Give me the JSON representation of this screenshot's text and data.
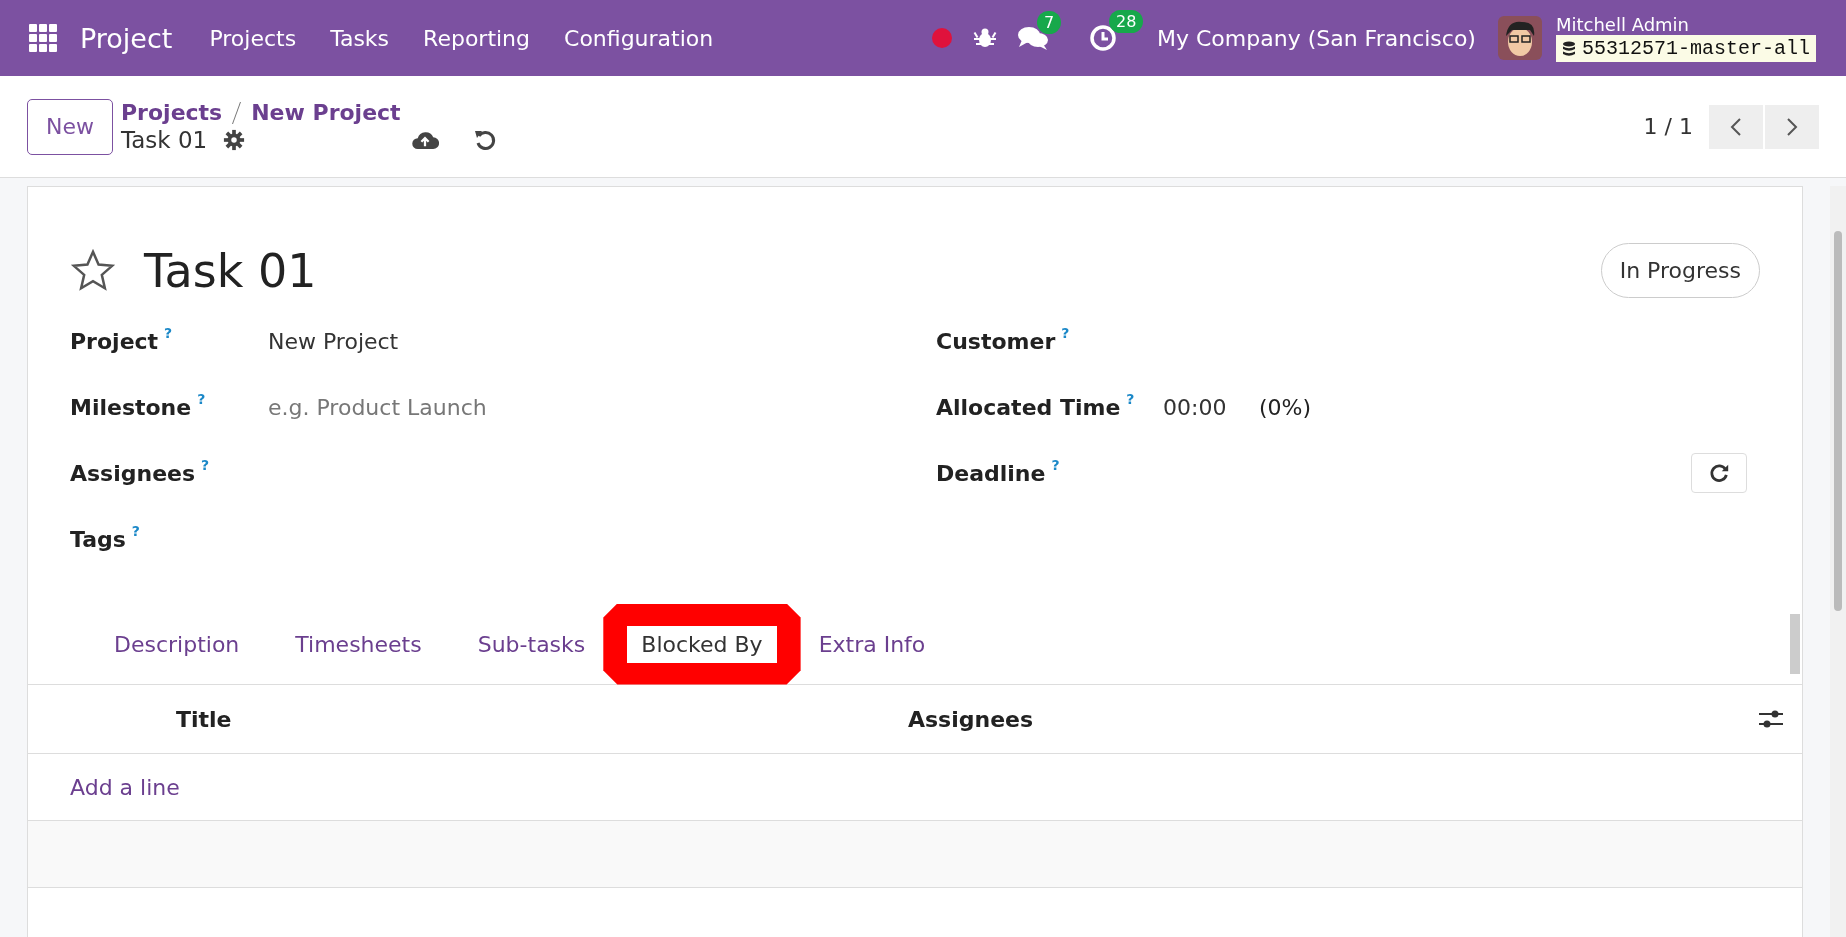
{
  "navbar": {
    "app_name": "Project",
    "menu": [
      "Projects",
      "Tasks",
      "Reporting",
      "Configuration"
    ],
    "messages_count": "7",
    "activities_count": "28",
    "company": "My Company (San Francisco)",
    "user_name": "Mitchell Admin",
    "database": "55312571-master-all"
  },
  "control_panel": {
    "new_button": "New",
    "breadcrumbs": [
      "Projects",
      "New Project"
    ],
    "record_name": "Task 01",
    "pager": "1 / 1"
  },
  "form": {
    "starred": false,
    "title": "Task 01",
    "stage": "In Progress",
    "left_fields": [
      {
        "label": "Project",
        "help": "?",
        "value": "New Project"
      },
      {
        "label": "Milestone",
        "help": "?",
        "placeholder": "e.g. Product Launch"
      },
      {
        "label": "Assignees",
        "help": "?"
      },
      {
        "label": "Tags",
        "help": "?"
      }
    ],
    "right_fields": [
      {
        "kind": "text",
        "label": "Customer",
        "help": "?"
      },
      {
        "kind": "time",
        "label": "Allocated Time",
        "help": "?",
        "value": "00:00",
        "percent": "(0%)"
      },
      {
        "kind": "date",
        "label": "Deadline",
        "help": "?"
      }
    ],
    "tabs": [
      {
        "label": "Description",
        "selected": false,
        "highlighted": false
      },
      {
        "label": "Timesheets",
        "selected": false,
        "highlighted": false
      },
      {
        "label": "Sub-tasks",
        "selected": false,
        "highlighted": false
      },
      {
        "label": "Blocked By",
        "selected": true,
        "highlighted": true
      },
      {
        "label": "Extra Info",
        "selected": false,
        "highlighted": false
      }
    ],
    "table": {
      "columns": [
        "Title",
        "Assignees"
      ],
      "add_line": "Add a line"
    }
  }
}
